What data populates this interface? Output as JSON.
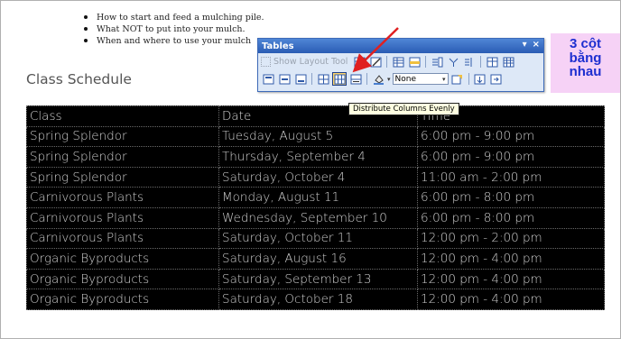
{
  "bullets": [
    "How to start and feed a mulching pile.",
    "What NOT to put into your mulch.",
    "When and where to use your mulch"
  ],
  "heading": "Class Schedule",
  "schedule": {
    "header": [
      "Class",
      "Date",
      "Time"
    ],
    "rows": [
      [
        "Spring Splendor",
        "Tuesday, August 5",
        "6:00 pm - 9:00 pm"
      ],
      [
        "Spring Splendor",
        "Thursday, September 4",
        "6:00 pm - 9:00 pm"
      ],
      [
        "Spring Splendor",
        "Saturday, October 4",
        "11:00 am - 2:00 pm"
      ],
      [
        "Carnivorous Plants",
        "Monday, August 11",
        "6:00 pm - 8:00 pm"
      ],
      [
        "Carnivorous Plants",
        "Wednesday, September 10",
        "6:00 pm - 8:00 pm"
      ],
      [
        "Carnivorous Plants",
        "Saturday, October 11",
        "12:00 pm - 2:00 pm"
      ],
      [
        "Organic Byproducts",
        "Saturday, August 16",
        "12:00 pm - 4:00 pm"
      ],
      [
        "Organic Byproducts",
        "Saturday, September 13",
        "12:00 pm - 4:00 pm"
      ],
      [
        "Organic Byproducts",
        "Saturday, October 18",
        "12:00 pm - 4:00 pm"
      ]
    ]
  },
  "toolbar": {
    "title": "Tables",
    "dropdown_glyph": "▾",
    "close_glyph": "×",
    "show_layout_label": "Show Layout Tool",
    "border_style_value": "None",
    "tooltip": "Distribute Columns Evenly",
    "icons_row1": [
      "show-layout-tool-icon",
      "draw-layout-table-icon",
      "draw-layout-cell-icon",
      "insert-table-icon",
      "insert-rows-icon",
      "insert-columns-icon",
      "merge-cells-icon",
      "split-cells-icon"
    ],
    "icons_row2": [
      "align-top-icon",
      "center-vertically-icon",
      "align-bottom-icon",
      "distribute-rows-evenly-icon",
      "distribute-columns-evenly-icon",
      "autofit-to-contents-icon",
      "fill-color-icon",
      "border-style-icon",
      "table-properties-icon",
      "cell-properties-icon"
    ]
  },
  "annotation": {
    "lines": [
      "3 cột",
      "bằng",
      "nhau"
    ],
    "arrow_color": "#e02020",
    "text_color": "#1e2fd0",
    "box_color": "#f6d2f6"
  },
  "colors": {
    "table_bg": "#000000",
    "table_text": "#cfcfcf",
    "toolbar_bg": "#dde8f7",
    "titlebar": "#2a5cb4",
    "tooltip_bg": "#ffffe1"
  }
}
